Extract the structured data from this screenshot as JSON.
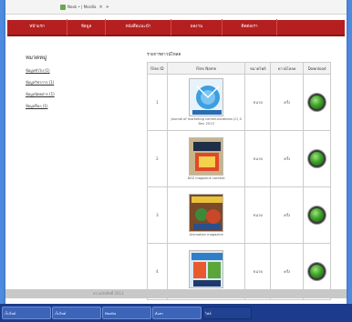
{
  "browser": {
    "tab_label": "Nook • | Mozilla"
  },
  "nav": {
    "items": [
      "หน้าแรก",
      "ข้อมูล",
      "หนังสือแนะนำ",
      "ผลงาน",
      "ติดต่อเรา"
    ]
  },
  "sidebar": {
    "title": "หมวดหมู่",
    "links": [
      "ข้อมูลทั่วไป (1)",
      "ข้อมูลวิชาการ (1)",
      "ข้อมูลนิตยสาร (1)",
      "ข้อมูลอื่นๆ (1)"
    ]
  },
  "content": {
    "title": "รายการดาวน์โหลด",
    "columns": [
      "Files ID",
      "Files Name",
      "ขนาดไฟล์",
      "ดาวน์โหลด",
      "Download"
    ],
    "rows": [
      {
        "id": "1",
        "caption": "Journal of marketing communications (C) 4 Dec 2013",
        "size": "ขนาด",
        "downloads": "ครั้ง",
        "cover": "journal-cover"
      },
      {
        "id": "2",
        "caption": "DEZ magazine content",
        "size": "ขนาด",
        "downloads": "ครั้ง",
        "cover": "dez-magazine-cover"
      },
      {
        "id": "3",
        "caption": "Animation magazine",
        "size": "ขนาด",
        "downloads": "ครั้ง",
        "cover": "animation-cover"
      },
      {
        "id": "4",
        "caption": "Animation magazine",
        "size": "ขนาด",
        "downloads": "ครั้ง",
        "cover": "magazine-cover"
      }
    ]
  },
  "footer": {
    "text": "สงวนลิขสิทธิ์ 2013"
  },
  "taskbar": {
    "buttons": [
      "เว็บไซต์",
      "เว็บไซต์",
      "Mozilla",
      "ค้นหา",
      "ไฟล์"
    ]
  },
  "colors": {
    "nav_red": "#b51f20",
    "desktop_blue": "#4d8be0",
    "taskbar_blue": "#1c3b8a",
    "download_green": "#3ea22a"
  }
}
